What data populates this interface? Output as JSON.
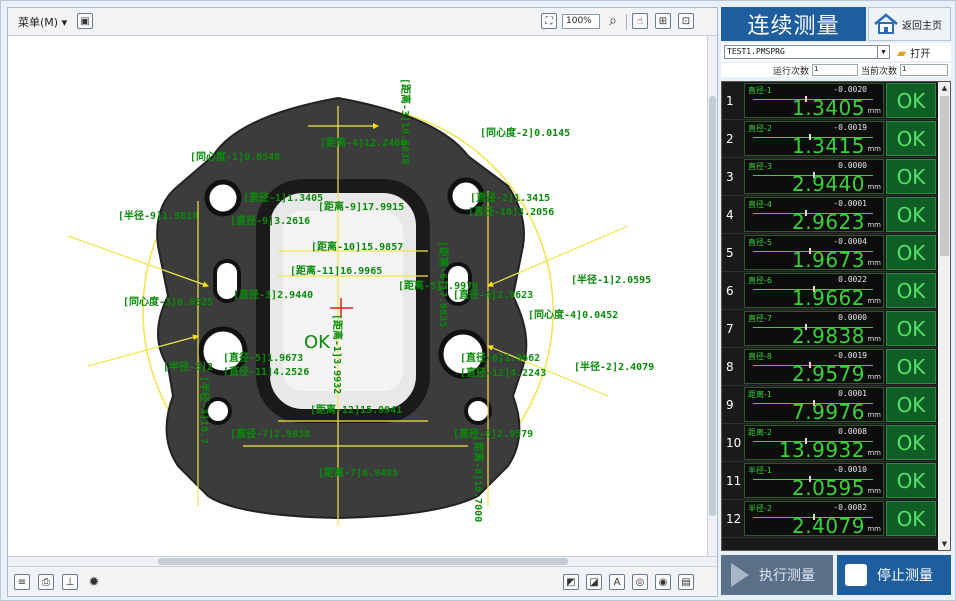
{
  "toolbar": {
    "menu_label": "菜单(M)",
    "zoom_value": "100%"
  },
  "canvas": {
    "ok_text": "OK",
    "labels": [
      "[距离-4]12.2400",
      "[同心度-2]0.0145",
      "[同心度-1]0.0548",
      "[直径-1]1.3405",
      "[直径-2]1.3415",
      "[距离-9]17.9915",
      "[直径-9]3.2616",
      "[直径-10]3.2056",
      "[半径-9]1.9810",
      "[距离-10]15.9857",
      "[距离-11]16.9965",
      "[直径-3]2.9440",
      "[距离-5]7.9976",
      "[直径-4]2.9623",
      "[半径-1]2.0595",
      "[同心度-3]0.0325",
      "[同心度-4]0.0452",
      "[直径-5]1.9673",
      "[直径-11]4.2526",
      "[直径-6]1.9662",
      "[直径-12]4.2243",
      "[半径-2]2.4079",
      "[半径-3]2",
      "[距离-12]15.9941",
      "[直径-7]2.9838",
      "[直径-8]2.9579",
      "[距离-7]6.9495"
    ],
    "vertical_labels": [
      "[距离-3]10.6838",
      "[距离-6]17.9835",
      "[距离-1]3.9932",
      "[距离-8]10.7000",
      "[半径-3]10.7"
    ]
  },
  "panel": {
    "title": "连续测量",
    "home_label": "返回主页",
    "file_name": "TEST1.PMSPRG",
    "open_label": "打开",
    "run_count_label": "运行次数",
    "run_count_value": "1",
    "current_count_label": "当前次数",
    "current_count_value": "1"
  },
  "measurements": [
    {
      "idx": "1",
      "name": "直径-1",
      "dev": "-0.0020",
      "value": "1.3405",
      "unit": "mm",
      "result": "OK"
    },
    {
      "idx": "2",
      "name": "直径-2",
      "dev": "-0.0019",
      "value": "1.3415",
      "unit": "mm",
      "result": "OK"
    },
    {
      "idx": "3",
      "name": "直径-3",
      "dev": "0.0000",
      "value": "2.9440",
      "unit": "mm",
      "result": "OK"
    },
    {
      "idx": "4",
      "name": "直径-4",
      "dev": "-0.0001",
      "value": "2.9623",
      "unit": "mm",
      "result": "OK"
    },
    {
      "idx": "5",
      "name": "直径-5",
      "dev": "-0.0004",
      "value": "1.9673",
      "unit": "mm",
      "result": "OK"
    },
    {
      "idx": "6",
      "name": "直径-6",
      "dev": "0.0022",
      "value": "1.9662",
      "unit": "mm",
      "result": "OK"
    },
    {
      "idx": "7",
      "name": "直径-7",
      "dev": "0.0000",
      "value": "2.9838",
      "unit": "mm",
      "result": "OK"
    },
    {
      "idx": "8",
      "name": "直径-8",
      "dev": "-0.0019",
      "value": "2.9579",
      "unit": "mm",
      "result": "OK"
    },
    {
      "idx": "9",
      "name": "距离-1",
      "dev": "0.0001",
      "value": "7.9976",
      "unit": "mm",
      "result": "OK"
    },
    {
      "idx": "10",
      "name": "距离-2",
      "dev": "0.0008",
      "value": "13.9932",
      "unit": "mm",
      "result": "OK"
    },
    {
      "idx": "11",
      "name": "半径-1",
      "dev": "-0.0010",
      "value": "2.0595",
      "unit": "mm",
      "result": "OK"
    },
    {
      "idx": "12",
      "name": "半径-2",
      "dev": "-0.0082",
      "value": "2.4079",
      "unit": "mm",
      "result": "OK"
    }
  ],
  "actions": {
    "execute_label": "执行测量",
    "stop_label": "停止测量"
  }
}
